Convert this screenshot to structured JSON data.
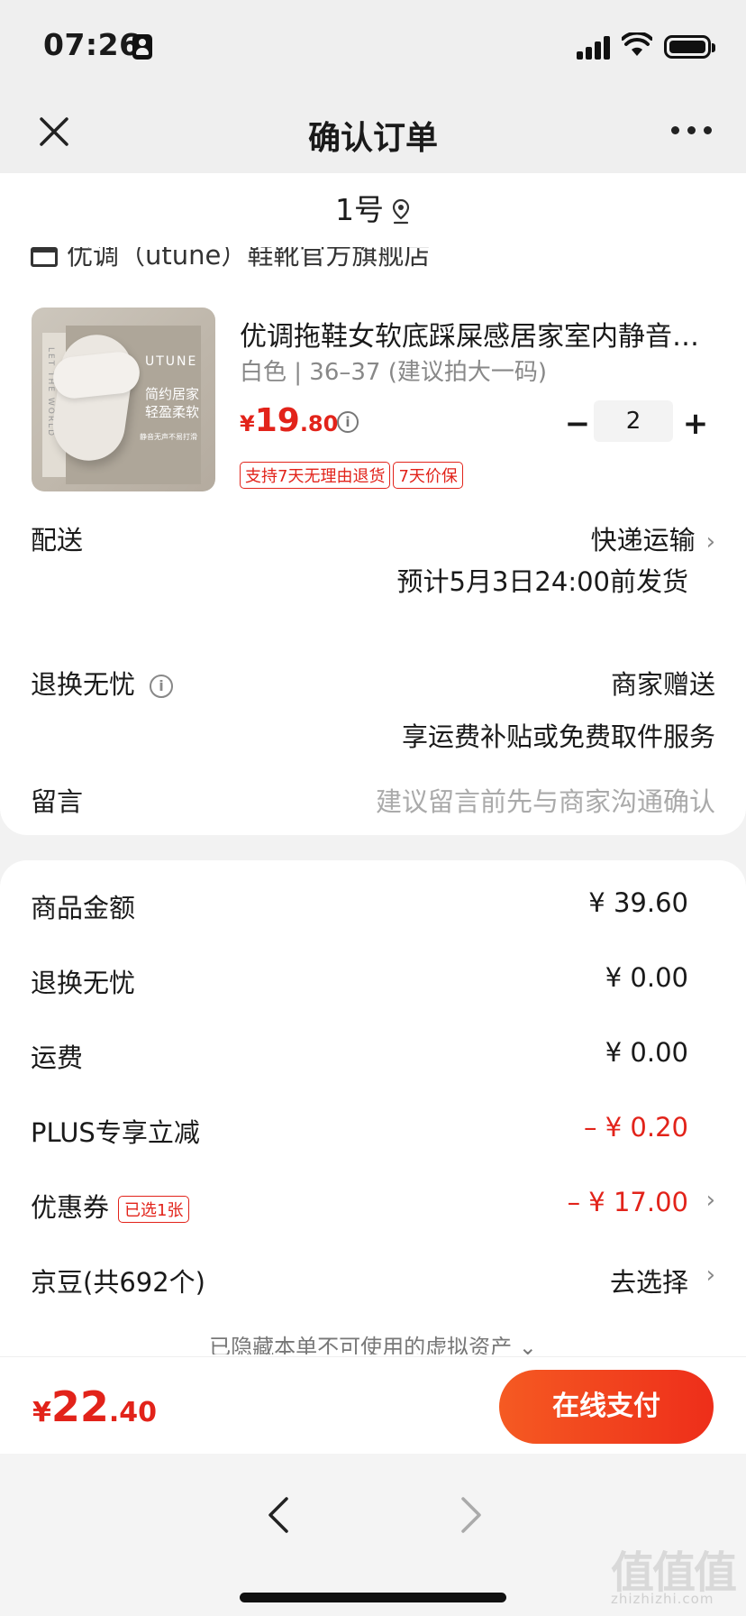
{
  "status_bar": {
    "time": "07:26"
  },
  "nav": {
    "title": "确认订单"
  },
  "address": {
    "text": "1号"
  },
  "shop": {
    "name": "优调（utune）鞋靴官方旗舰店"
  },
  "product": {
    "title": "优调拖鞋女软底踩屎感居家室内静音…",
    "spec": "白色 | 36–37 (建议拍大一码)",
    "price_symbol": "¥",
    "price_int": "19",
    "price_dec": ".80",
    "quantity": "2",
    "minus_label": "−",
    "plus_label": "+",
    "tags": [
      "支持7天无理由退货",
      "7天价保"
    ],
    "image_text": {
      "brand": "UTUNE",
      "slogan": "简约居家 轻盈柔软",
      "sub": "静音无声不易打滑",
      "side": "LET THE WORLD"
    }
  },
  "delivery": {
    "label": "配送",
    "method": "快递运输",
    "estimate": "预计5月3日24:00前发货"
  },
  "return_service": {
    "label": "退换无忧",
    "value": "商家赠送",
    "detail": "享运费补贴或免费取件服务"
  },
  "message": {
    "label": "留言",
    "placeholder": "建议留言前先与商家沟通确认"
  },
  "summary": {
    "goods_label": "商品金额",
    "goods_value": "¥ 39.60",
    "return_label": "退换无忧",
    "return_value": "¥ 0.00",
    "shipping_label": "运费",
    "shipping_value": "¥ 0.00",
    "plus_label": "PLUS专享立减",
    "plus_value": "– ¥ 0.20",
    "coupon_label": "优惠券",
    "coupon_tag": "已选1张",
    "coupon_value": "– ¥ 17.00",
    "jingdou_label": "京豆(共692个)",
    "jingdou_value": "去选择"
  },
  "hidden_note": "已隐藏本单不可使用的虚拟资产 ⌄",
  "pay": {
    "total_symbol": "¥",
    "total_int": "22",
    "total_dec": ".40",
    "button_label": "在线支付"
  },
  "watermark": {
    "main": "值值值",
    "sub": "zhizhizhi.com"
  },
  "colors": {
    "accent_red": "#e2231a",
    "pay_gradient_start": "#f55a22",
    "pay_gradient_end": "#ee2e1a"
  }
}
